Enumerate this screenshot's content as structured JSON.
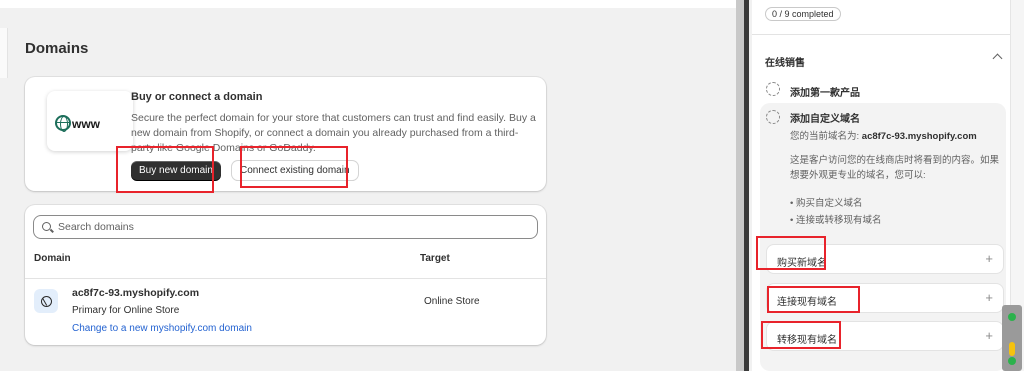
{
  "main": {
    "title": "Domains",
    "buy_card": {
      "illustration_text": "www",
      "title": "Buy or connect a domain",
      "description": "Secure the perfect domain for your store that customers can trust and find easily. Buy a new domain from Shopify, or connect a domain you already purchased from a third-party like Google Domains or GoDaddy.",
      "buy_button": "Buy new domain",
      "connect_button": "Connect existing domain"
    },
    "list_card": {
      "search_placeholder": "Search domains",
      "columns": [
        "Domain",
        "Target"
      ],
      "rows": [
        {
          "domain": "ac8f7c-93.myshopify.com",
          "subtitle": "Primary for Online Store",
          "link": "Change to a new myshopify.com domain",
          "target": "Online Store"
        }
      ]
    }
  },
  "right_panel": {
    "progress": "0 / 9 completed",
    "section_title": "在线销售",
    "tasks": [
      {
        "label": "添加第一款产品"
      },
      {
        "label": "添加自定义域名"
      }
    ],
    "current_domain_prefix": "您的当前域名为:",
    "current_domain": "ac8f7c-93.myshopify.com",
    "explanation": "这是客户访问您的在线商店时将看到的内容。如果想要外观更专业的域名，您可以:",
    "bullets": [
      "购买自定义域名",
      "连接或转移现有域名"
    ],
    "options": [
      {
        "label": "购买新域名",
        "icon": "plus-icon"
      },
      {
        "label": "连接现有域名",
        "icon": "plus-icon"
      },
      {
        "label": "转移现有域名",
        "icon": "plus-icon"
      }
    ]
  },
  "colors": {
    "annotation_red": "#e8232b",
    "link_blue": "#2463d1",
    "dark_button": "#303030"
  }
}
